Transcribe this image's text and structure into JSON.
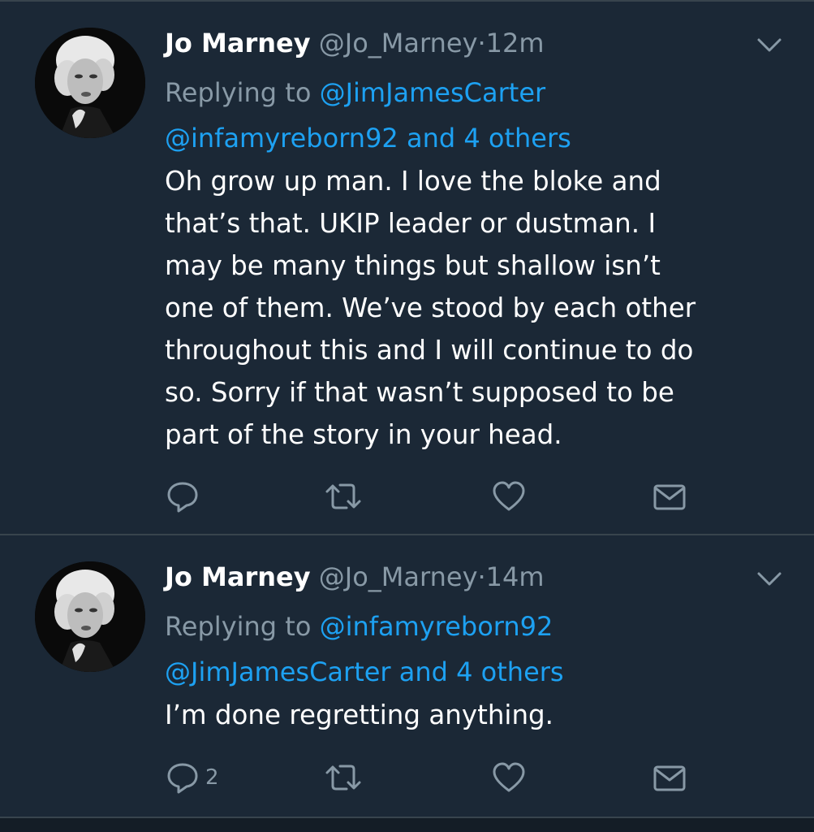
{
  "colors": {
    "background": "#1b2836",
    "divider": "#38444d",
    "secondary_text": "#8899a6",
    "link": "#1da1f2"
  },
  "tweets": [
    {
      "name": "Jo Marney",
      "handle": "@Jo_Marney",
      "separator": "·",
      "time": "12m",
      "replying_prefix": "Replying to",
      "reply_to_1": "@JimJamesCarter",
      "reply_to_2": "@infamyreborn92",
      "reply_and": "and",
      "reply_others": "4 others",
      "body_lines": [
        "Oh grow up man. I love the bloke and",
        "that’s that. UKIP leader or dustman. I",
        "may be many things but shallow isn’t",
        "one of them. We’ve stood by each other",
        "throughout this and I will continue to do",
        "so. Sorry if that wasn’t supposed to be",
        "part of the story in your head."
      ],
      "reply_count": "",
      "icons": [
        "reply-icon",
        "retweet-icon",
        "like-icon",
        "dm-icon",
        "chevron-down-icon"
      ]
    },
    {
      "name": "Jo Marney",
      "handle": "@Jo_Marney",
      "separator": "·",
      "time": "14m",
      "replying_prefix": "Replying to",
      "reply_to_1": "@infamyreborn92",
      "reply_to_2": "@JimJamesCarter",
      "reply_and": "and",
      "reply_others": "4 others",
      "body_lines": [
        "I’m done regretting anything."
      ],
      "reply_count": "2",
      "icons": [
        "reply-icon",
        "retweet-icon",
        "like-icon",
        "dm-icon",
        "chevron-down-icon"
      ]
    }
  ]
}
